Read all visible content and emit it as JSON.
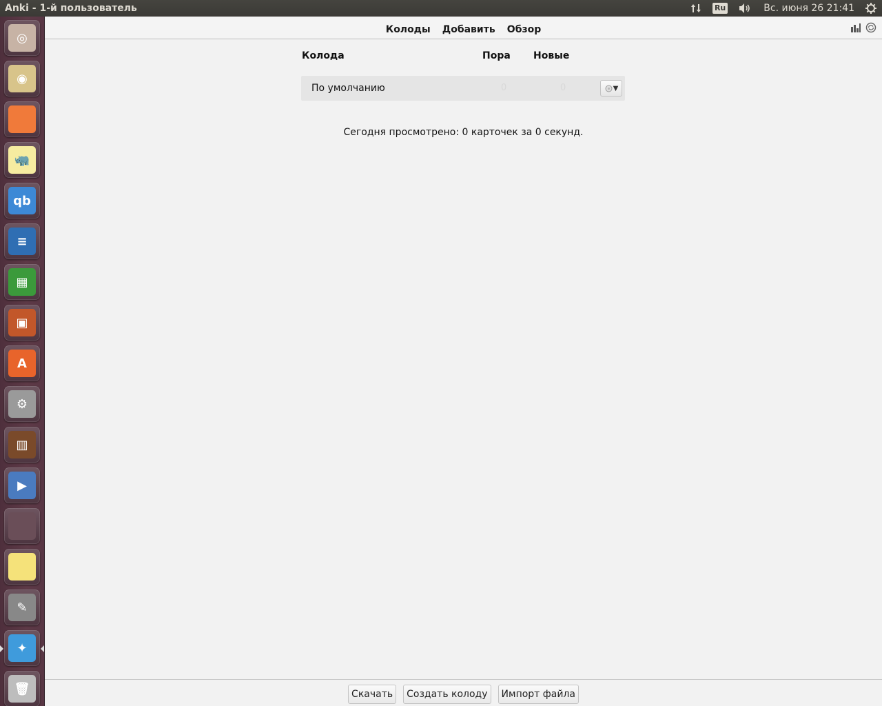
{
  "window": {
    "title": "Anki - 1-й пользователь"
  },
  "tray": {
    "keyboard_layout": "Ru",
    "clock": "Вс. июня 26 21:41",
    "icons": [
      "network-updown-icon",
      "keyboard-layout-icon",
      "volume-icon",
      "power-gear-icon"
    ]
  },
  "launcher": {
    "items": [
      {
        "name": "ubuntu-dash-icon",
        "glyph": "◎",
        "color": "#c7b3a5"
      },
      {
        "name": "rhythmbox-speaker-icon",
        "glyph": "◉",
        "color": "#d8c48a"
      },
      {
        "name": "files-folder-icon",
        "glyph": "",
        "color": "#f07a3a"
      },
      {
        "name": "sticky-rhino-icon",
        "glyph": "🦏",
        "color": "#f6eca0"
      },
      {
        "name": "qbittorrent-icon",
        "glyph": "qb",
        "color": "#3d89d6"
      },
      {
        "name": "libreoffice-writer-icon",
        "glyph": "≡",
        "color": "#2f6eb3"
      },
      {
        "name": "libreoffice-calc-icon",
        "glyph": "▦",
        "color": "#3b9a3b"
      },
      {
        "name": "libreoffice-impress-icon",
        "glyph": "▣",
        "color": "#c2572a"
      },
      {
        "name": "software-center-icon",
        "glyph": "A",
        "color": "#e8642b"
      },
      {
        "name": "system-settings-icon",
        "glyph": "⚙",
        "color": "#9a9a9a"
      },
      {
        "name": "library-books-icon",
        "glyph": "▥",
        "color": "#7a4a2a"
      },
      {
        "name": "video-player-icon",
        "glyph": "▶",
        "color": "#4a7bbf"
      },
      {
        "name": "blank-app-icon",
        "glyph": "",
        "color": "#6a4e58"
      },
      {
        "name": "sticky-notes-icon",
        "glyph": "",
        "color": "#f5e27a"
      },
      {
        "name": "gimp-icon",
        "glyph": "✎",
        "color": "#888"
      },
      {
        "name": "anki-star-icon",
        "glyph": "✦",
        "color": "#3f9bdc"
      },
      {
        "name": "trash-icon",
        "glyph": "🗑",
        "color": "#bdbdbd"
      }
    ]
  },
  "toolbar": {
    "links": [
      "Колоды",
      "Добавить",
      "Обзор"
    ],
    "right_icons": [
      "stats-icon",
      "sync-icon"
    ]
  },
  "deck_table": {
    "headers": {
      "deck": "Колода",
      "due": "Пора",
      "new": "Новые"
    },
    "rows": [
      {
        "name": "По умолчанию",
        "due": "0",
        "new": "0"
      }
    ]
  },
  "stats_text": "Сегодня просмотрено: 0 карточек за 0 секунд.",
  "bottom": {
    "buttons": [
      "Скачать",
      "Создать колоду",
      "Импорт файла"
    ]
  }
}
